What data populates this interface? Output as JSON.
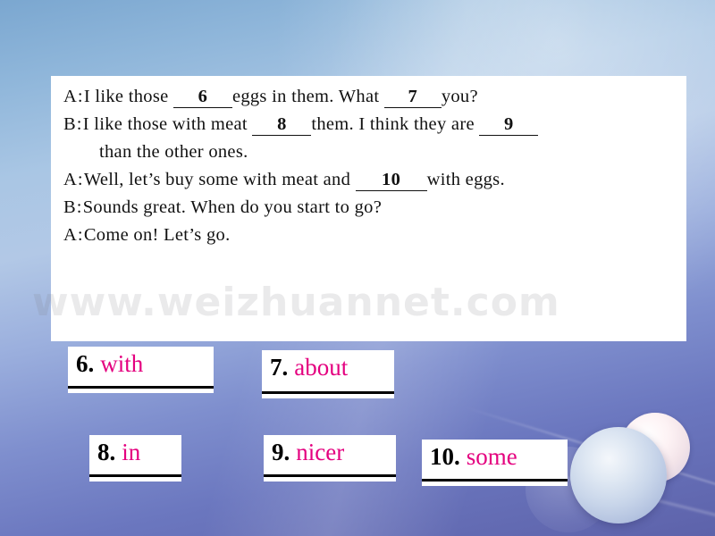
{
  "background": {
    "top_color": "#8fb6da",
    "bottom_color": "#5d62aa",
    "sphere_large_color": "#c9d6ea",
    "sphere_small_color": "#f3e4e9"
  },
  "watermark": {
    "text": "www.weizhuannet.com"
  },
  "dialogue": {
    "lines": [
      {
        "speaker": "A",
        "colon": ":",
        "parts": [
          {
            "type": "text",
            "value": "I like those "
          },
          {
            "type": "blank",
            "value": "6"
          },
          {
            "type": "text",
            "value": "eggs in them. What "
          },
          {
            "type": "blank",
            "value": "7"
          },
          {
            "type": "text",
            "value": "you?"
          }
        ]
      },
      {
        "speaker": "B",
        "colon": ":",
        "parts": [
          {
            "type": "text",
            "value": "I like those with meat "
          },
          {
            "type": "blank",
            "value": "8"
          },
          {
            "type": "text",
            "value": "them. I think they are "
          },
          {
            "type": "blank",
            "value": "9"
          }
        ]
      },
      {
        "speaker": "",
        "colon": "",
        "indent": true,
        "parts": [
          {
            "type": "text",
            "value": "than the other ones."
          }
        ]
      },
      {
        "speaker": "A",
        "colon": ":",
        "parts": [
          {
            "type": "text",
            "value": "Well, let’s buy some with meat and "
          },
          {
            "type": "blank",
            "value": "10"
          },
          {
            "type": "text",
            "value": "with eggs."
          }
        ]
      },
      {
        "speaker": "B",
        "colon": ":",
        "parts": [
          {
            "type": "text",
            "value": "Sounds great. When do you start to go?"
          }
        ]
      },
      {
        "speaker": "A",
        "colon": ":",
        "parts": [
          {
            "type": "text",
            "value": "Come on!  Let’s go."
          }
        ]
      }
    ],
    "line_1": {
      "speaker": "A",
      "colon": ":",
      "t1": "I like those ",
      "b1": "6",
      "t2": "eggs in them. What ",
      "b2": "7",
      "t3": "you?"
    },
    "line_2": {
      "speaker": "B",
      "colon": ":",
      "t1": "I like those with meat ",
      "b1": "8",
      "t2": "them. I think they are ",
      "b2": "9"
    },
    "line_3": {
      "t1": "than the other ones."
    },
    "line_4": {
      "speaker": "A",
      "colon": ":",
      "t1": "Well, let’s buy some with meat and ",
      "b1": "10",
      "t2": "with eggs."
    },
    "line_5": {
      "speaker": "B",
      "colon": ":",
      "t1": "Sounds great. When do you start to go?"
    },
    "line_6": {
      "speaker": "A",
      "colon": ":",
      "t1": "Come on!  Let’s go."
    }
  },
  "answers": {
    "accent_color": "#e4007f",
    "items": [
      {
        "num": "6.",
        "word": "with"
      },
      {
        "num": "7.",
        "word": "about"
      },
      {
        "num": "8.",
        "word": "in"
      },
      {
        "num": "9.",
        "word": "nicer"
      },
      {
        "num": "10.",
        "word": "some"
      }
    ]
  }
}
